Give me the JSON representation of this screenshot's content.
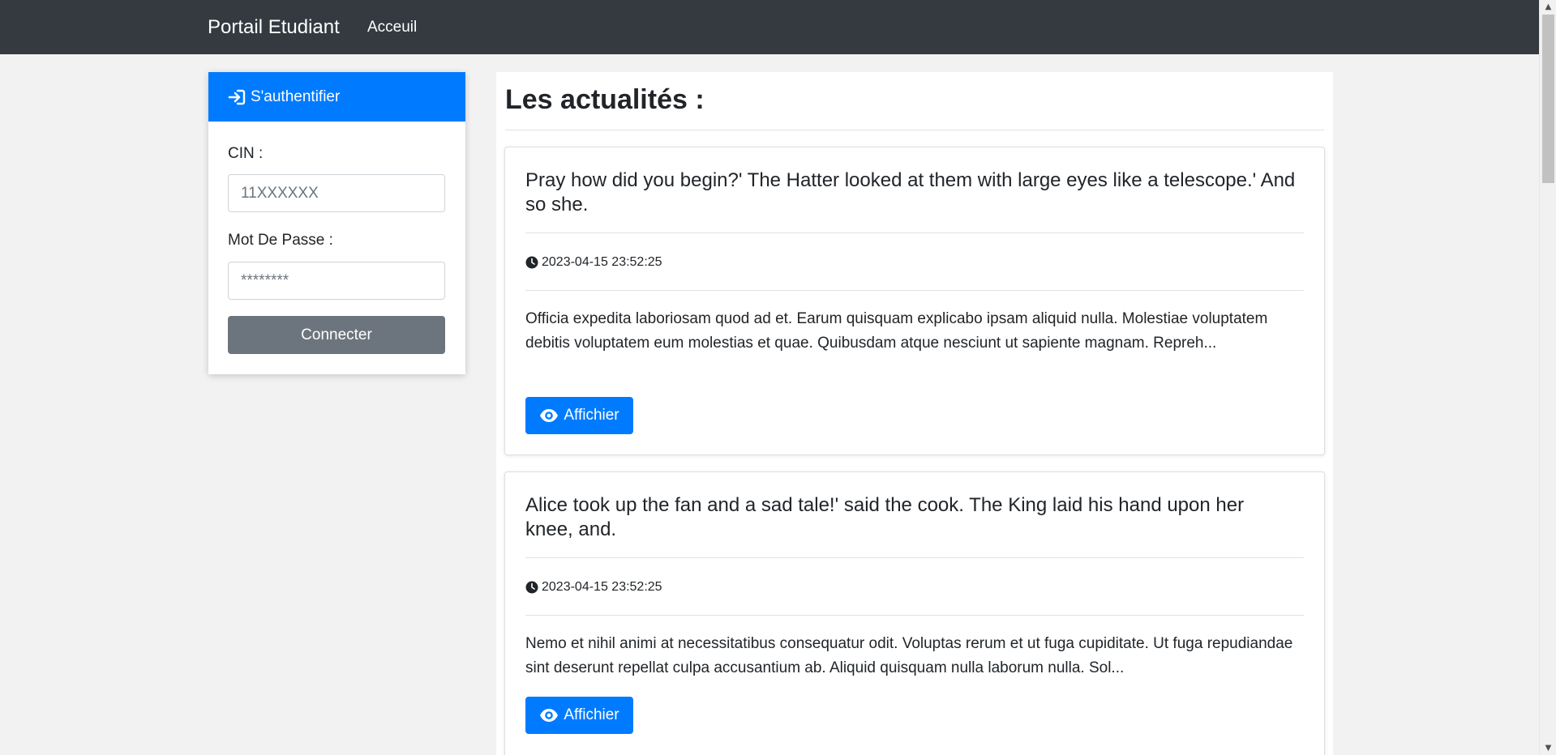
{
  "navbar": {
    "brand": "Portail Etudiant",
    "links": [
      {
        "label": "Acceuil"
      }
    ],
    "background": "#343a40"
  },
  "login": {
    "header": "S'authentifier",
    "header_icon": "sign-in-icon",
    "cin_label": "CIN :",
    "cin_placeholder": "11XXXXXX",
    "password_label": "Mot De Passe :",
    "password_placeholder": "********",
    "submit_label": "Connecter",
    "accent": "#007bff"
  },
  "news": {
    "title": "Les actualités :",
    "items": [
      {
        "title": "Pray how did you begin?' The Hatter looked at them with large eyes like a telescope.' And so she.",
        "date": "2023-04-15 23:52:25",
        "excerpt": "Officia expedita laboriosam quod ad et. Earum quisquam explicabo ipsam aliquid nulla. Molestiae voluptatem debitis voluptatem eum molestias et quae. Quibusdam atque nesciunt ut sapiente magnam. Repreh...",
        "button": "Affichier"
      },
      {
        "title": "Alice took up the fan and a sad tale!' said the cook. The King laid his hand upon her knee, and.",
        "date": "2023-04-15 23:52:25",
        "excerpt": "Nemo et nihil animi at necessitatibus consequatur odit. Voluptas rerum et ut fuga cupiditate. Ut fuga repudiandae sint deserunt repellat culpa accusantium ab. Aliquid quisquam nulla laborum nulla. Sol...",
        "button": "Affichier"
      }
    ]
  }
}
